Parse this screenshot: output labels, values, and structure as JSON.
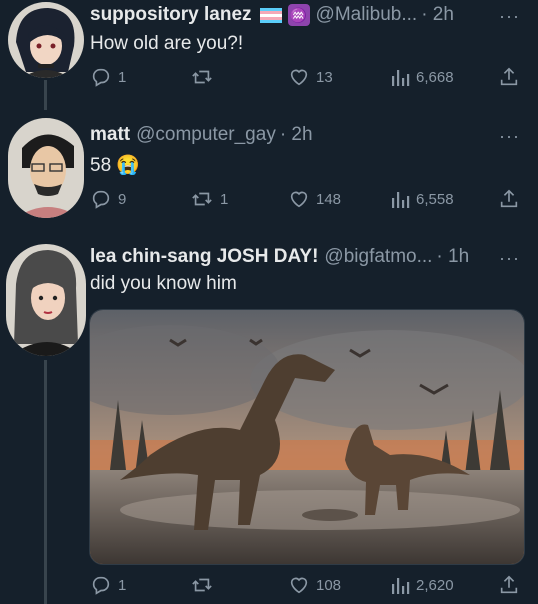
{
  "tweets": [
    {
      "name": "suppository lanez",
      "handle": "@Malibub...",
      "time": "· 2h",
      "text": "How old are you?!",
      "replies": "1",
      "retweets": "",
      "likes": "13",
      "views": "6,668"
    },
    {
      "name": "matt",
      "handle": "@computer_gay",
      "time": "· 2h",
      "text": "58 😭",
      "replies": "9",
      "retweets": "1",
      "likes": "148",
      "views": "6,558"
    },
    {
      "name": "lea chin-sang JOSH DAY!",
      "handle": "@bigfatmo...",
      "time": "· 1h",
      "text": "did you know him",
      "replies": "1",
      "retweets": "",
      "likes": "108",
      "views": "2,620"
    }
  ],
  "more_label": "···",
  "badge_symbol": "♒",
  "colors": {
    "background": "#15202b",
    "text": "#e7e9ea",
    "muted": "#8b98a5"
  },
  "icons": [
    "reply-icon",
    "retweet-icon",
    "like-icon",
    "views-icon",
    "share-icon",
    "more-icon"
  ]
}
